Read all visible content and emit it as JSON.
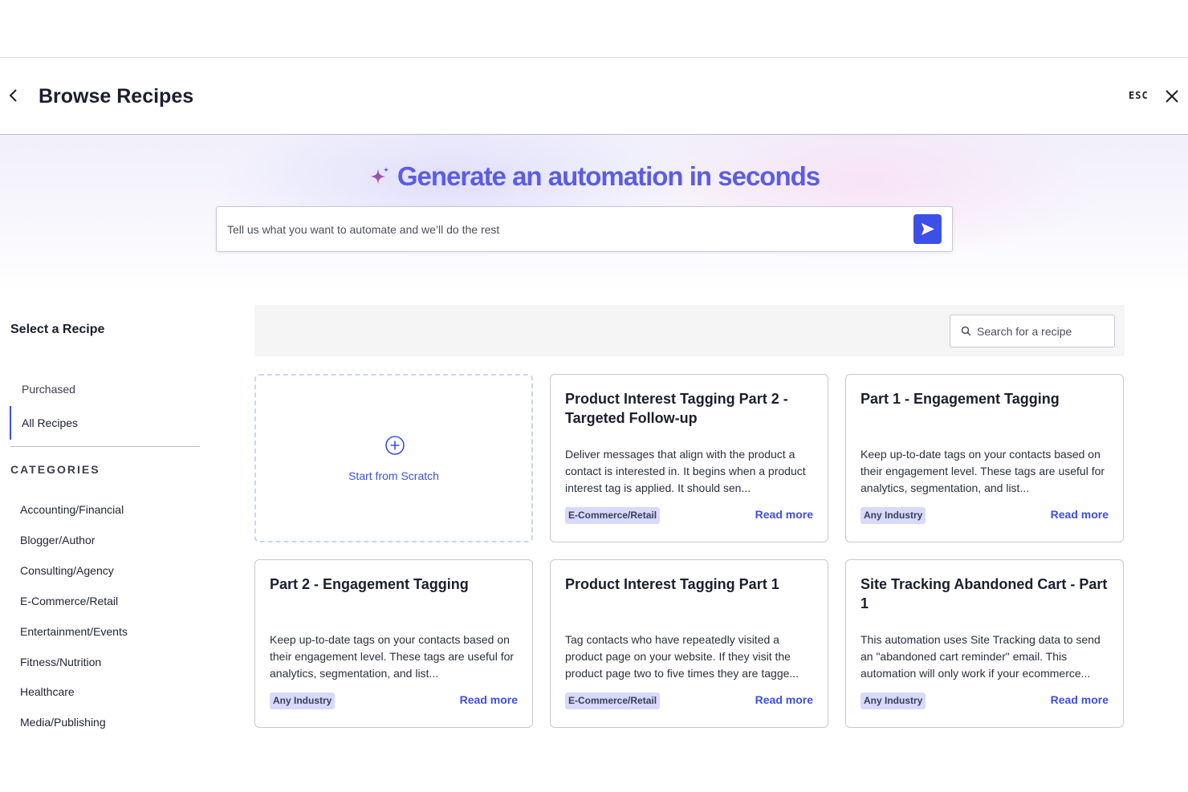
{
  "header": {
    "title": "Browse Recipes",
    "esc_label": "ESC"
  },
  "hero": {
    "heading": "Generate an automation in seconds",
    "prompt_placeholder": "Tell us what you want to automate and we’ll do the rest"
  },
  "sidebar": {
    "title": "Select a Recipe",
    "links": [
      {
        "label": "Purchased",
        "active": false
      },
      {
        "label": "All Recipes",
        "active": true
      }
    ],
    "categories_title": "CATEGORIES",
    "categories": [
      "Accounting/Financial",
      "Blogger/Author",
      "Consulting/Agency",
      "E-Commerce/Retail",
      "Entertainment/Events",
      "Fitness/Nutrition",
      "Healthcare",
      "Media/Publishing"
    ]
  },
  "search": {
    "placeholder": "Search for a recipe"
  },
  "scratch": {
    "label": "Start from Scratch"
  },
  "cards": [
    {
      "title": "Product Interest Tagging Part 2 - Targeted Follow-up",
      "description": "Deliver messages that align with the product a contact is interested in. It begins when a product interest tag is applied. It should sen...",
      "tag": "E-Commerce/Retail",
      "link": "Read more"
    },
    {
      "title": "Part 1 - Engagement Tagging",
      "description": "Keep up-to-date tags on your contacts based on their engagement level. These tags are useful for analytics, segmentation, and list...",
      "tag": "Any Industry",
      "link": "Read more"
    },
    {
      "title": "Part 2 - Engagement Tagging",
      "description": "Keep up-to-date tags on your contacts based on their engagement level. These tags are useful for analytics, segmentation, and list...",
      "tag": "Any Industry",
      "link": "Read more"
    },
    {
      "title": "Product Interest Tagging Part 1",
      "description": "Tag contacts who have repeatedly visited a product page on your website. If they visit the product page two to five times they are tagge...",
      "tag": "E-Commerce/Retail",
      "link": "Read more"
    },
    {
      "title": "Site Tracking Abandoned Cart - Part 1",
      "description": "This automation uses Site Tracking data to send an \"abandoned cart reminder\" email. This automation will only work if your ecommerce...",
      "tag": "Any Industry",
      "link": "Read more"
    }
  ],
  "colors": {
    "accent": "#3d4fe7",
    "heading": "#5b5ce6",
    "tag_bg": "#d8d9fb"
  }
}
